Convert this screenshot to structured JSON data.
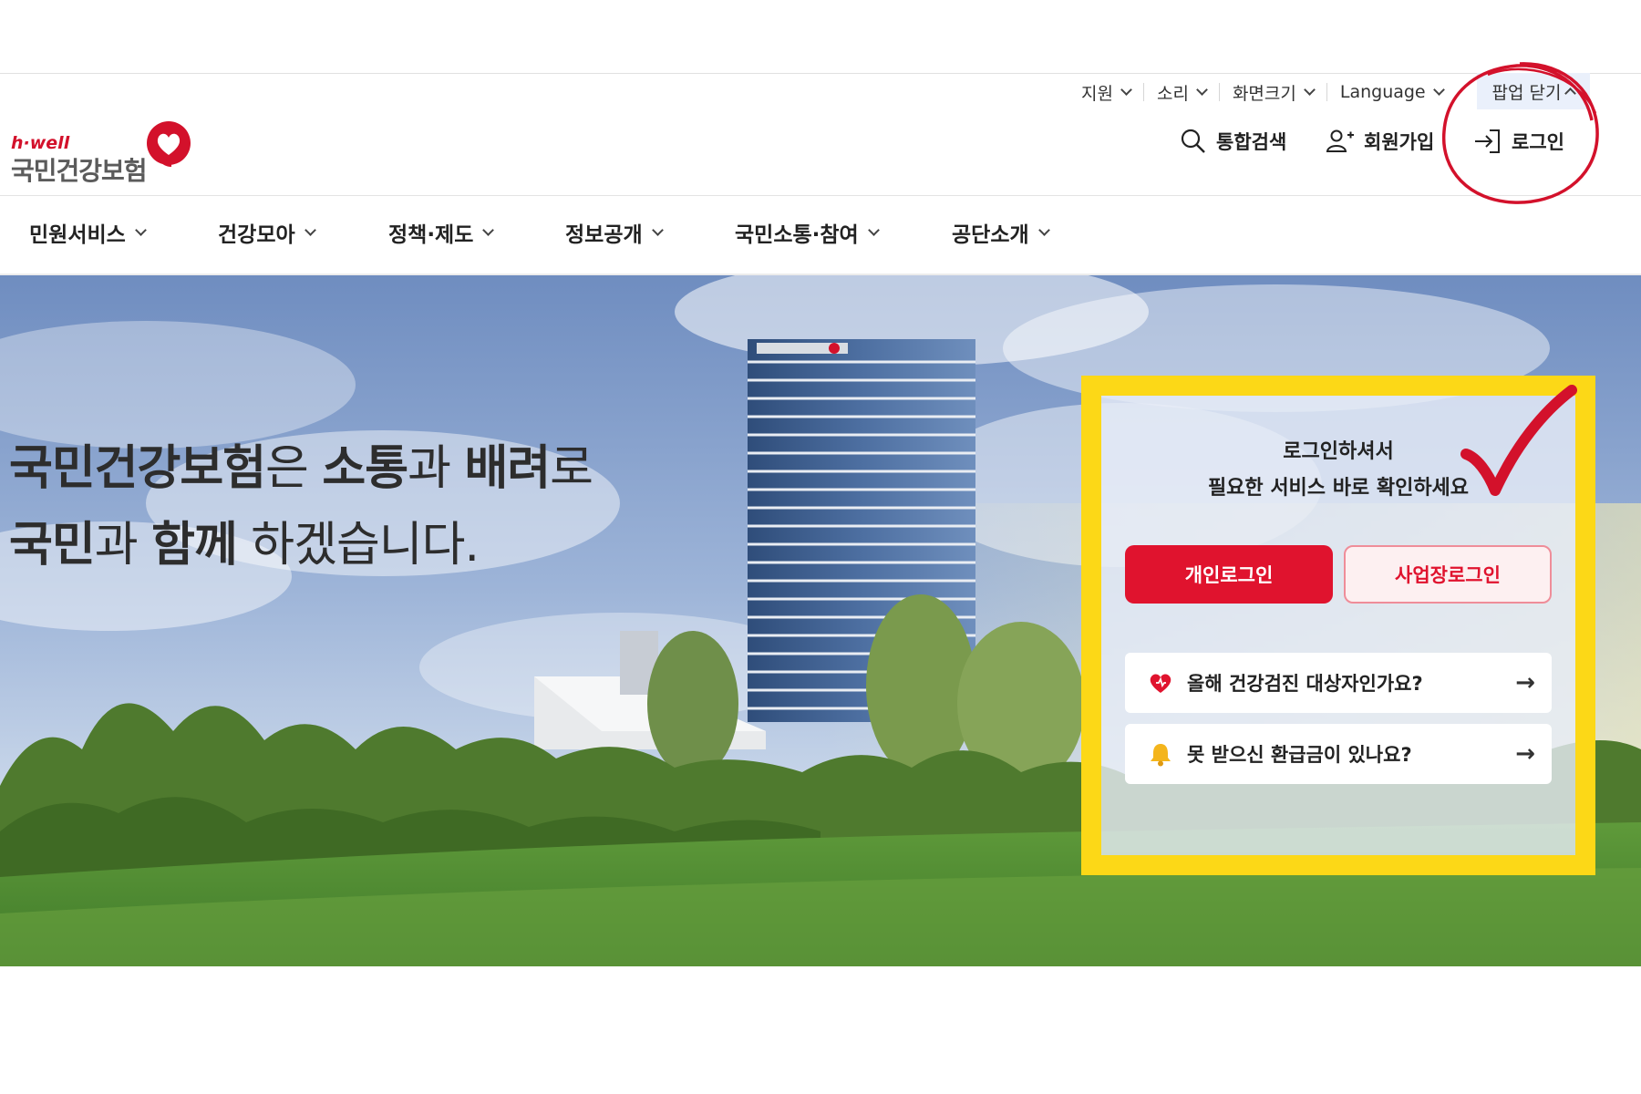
{
  "utility_bar": {
    "items": [
      "지원",
      "소리",
      "화면크기",
      "Language"
    ],
    "popup_close": "팝업 닫기"
  },
  "logo": {
    "en": "h·well",
    "ko": "국민건강보험"
  },
  "header_actions": {
    "search": "통합검색",
    "signup": "회원가입",
    "login": "로그인"
  },
  "main_nav": {
    "items": [
      "민원서비스",
      "건강모아",
      "정책·제도",
      "정보공개",
      "국민소통·참여",
      "공단소개"
    ]
  },
  "hero": {
    "line1": [
      {
        "text": "국민건강보험",
        "bold": true
      },
      {
        "text": "은 ",
        "bold": false
      },
      {
        "text": "소통",
        "bold": true
      },
      {
        "text": "과 ",
        "bold": false
      },
      {
        "text": "배려",
        "bold": true
      },
      {
        "text": "로",
        "bold": false
      }
    ],
    "line2": [
      {
        "text": "국민",
        "bold": true
      },
      {
        "text": "과 ",
        "bold": false
      },
      {
        "text": "함께",
        "bold": true
      },
      {
        "text": " 하겠습니다.",
        "bold": false
      }
    ]
  },
  "login_panel": {
    "message_line1": "로그인하셔서",
    "message_line2": "필요한 서비스 바로 확인하세요",
    "personal_login": "개인로그인",
    "business_login": "사업장로그인",
    "quick_links": [
      {
        "label": "올해 건강검진 대상자인가요?",
        "icon": "heart-icon",
        "arrow": "→"
      },
      {
        "label": "못 받으신 환급금이 있나요?",
        "icon": "bell-icon",
        "arrow": "→"
      }
    ]
  },
  "colors": {
    "brand_red": "#e0132e",
    "annotation_yellow": "#fcd817",
    "annotation_red": "#d3112b"
  }
}
